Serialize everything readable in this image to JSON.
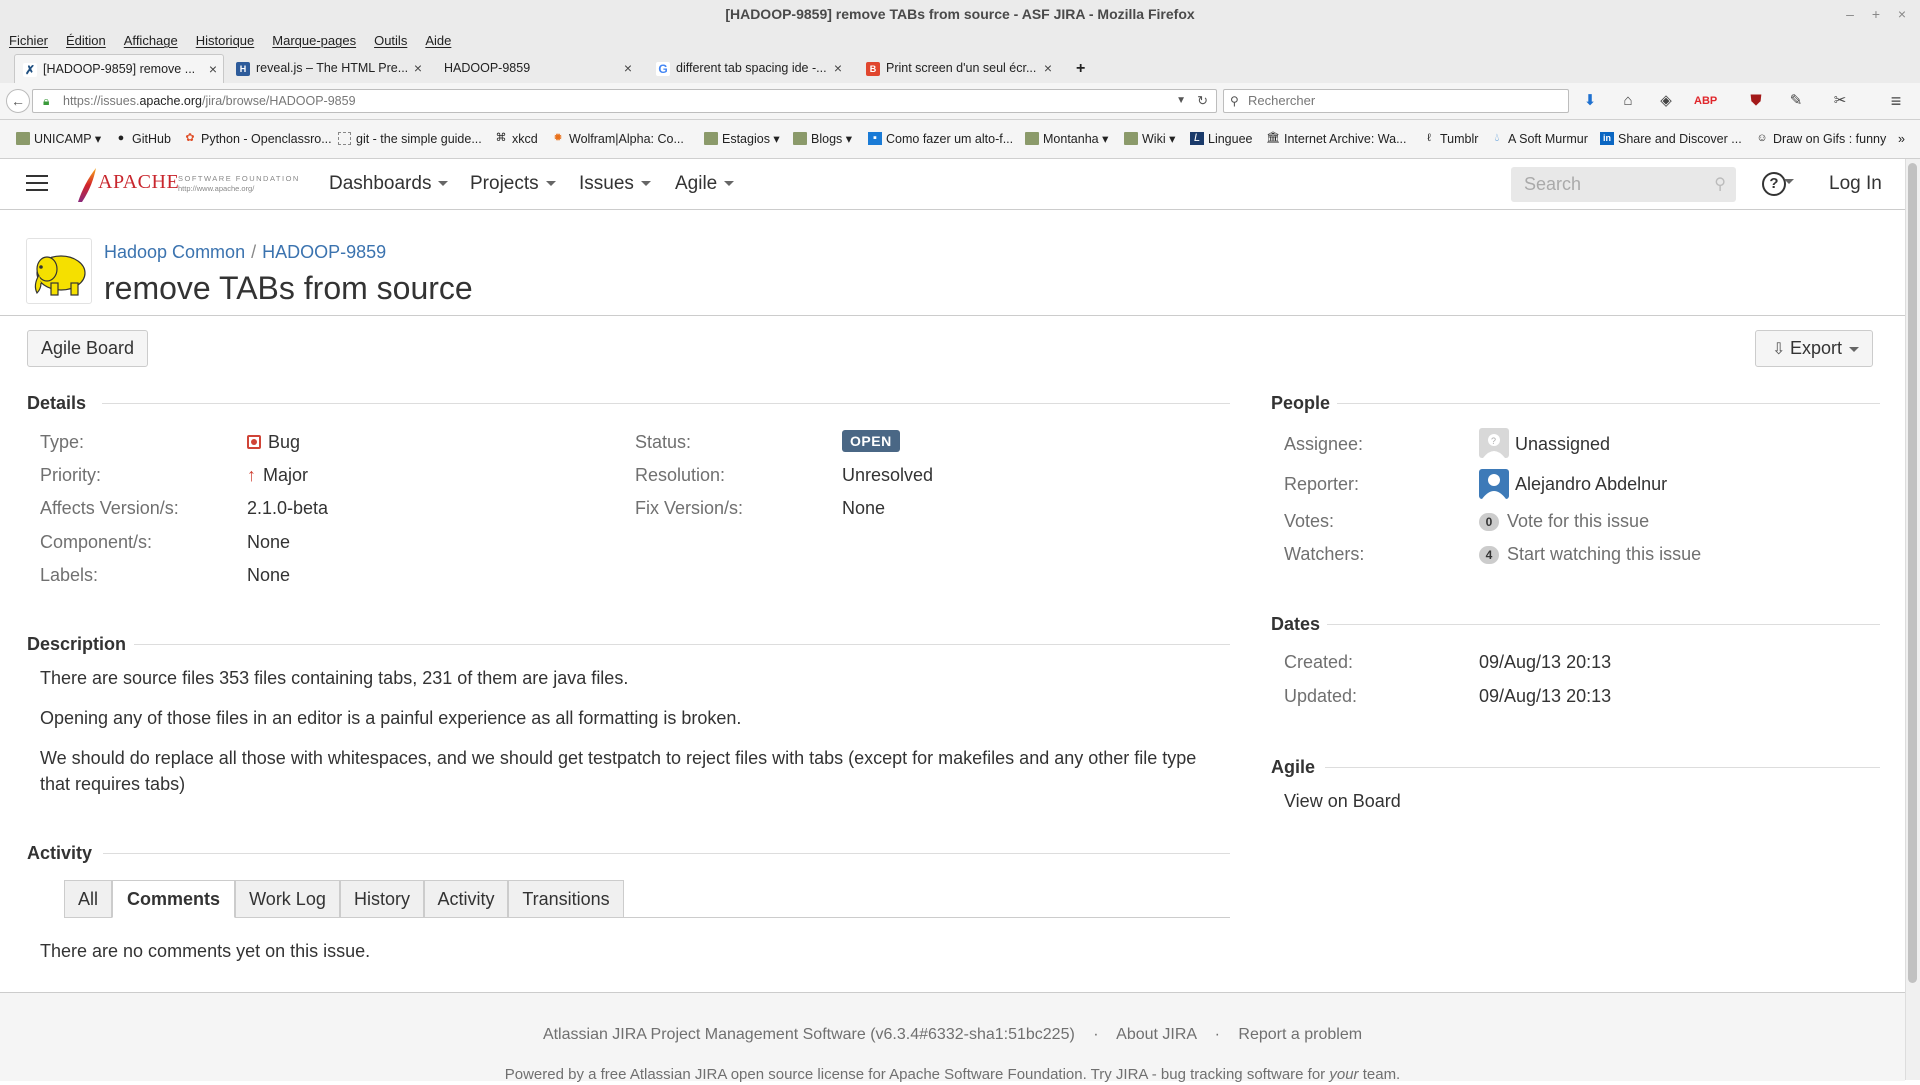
{
  "window": {
    "title": "[HADOOP-9859] remove TABs from source - ASF JIRA - Mozilla Firefox"
  },
  "menubar": [
    "Fichier",
    "Édition",
    "Affichage",
    "Historique",
    "Marque-pages",
    "Outils",
    "Aide"
  ],
  "tabs": [
    {
      "label": "[HADOOP-9859] remove ...",
      "active": true,
      "favicon": "jira-icon"
    },
    {
      "label": "reveal.js – The HTML Pre...",
      "active": false,
      "favicon": "reveal-icon"
    },
    {
      "label": "HADOOP-9859",
      "active": false,
      "favicon": ""
    },
    {
      "label": "different tab spacing ide -...",
      "active": false,
      "favicon": "google-icon"
    },
    {
      "label": "Print screen d'un seul écr...",
      "active": false,
      "favicon": "blogger-icon"
    }
  ],
  "navbar": {
    "url_prefix": "https://issues.",
    "url_domain": "apache.org",
    "url_path": "/jira/browse/HADOOP-9859",
    "search_placeholder": "Rechercher"
  },
  "bookmarks": [
    {
      "label": "UNICAMP",
      "type": "folder"
    },
    {
      "label": "GitHub",
      "type": "link"
    },
    {
      "label": "Python - Openclassro...",
      "type": "link"
    },
    {
      "label": "git - the simple guide...",
      "type": "link"
    },
    {
      "label": "xkcd",
      "type": "link"
    },
    {
      "label": "Wolfram|Alpha: Co...",
      "type": "link"
    },
    {
      "label": "Estagios",
      "type": "folder"
    },
    {
      "label": "Blogs",
      "type": "folder"
    },
    {
      "label": "Como fazer um alto-f...",
      "type": "link"
    },
    {
      "label": "Montanha",
      "type": "folder"
    },
    {
      "label": "Wiki",
      "type": "folder"
    },
    {
      "label": "Linguee",
      "type": "link"
    },
    {
      "label": "Internet Archive: Wa...",
      "type": "link"
    },
    {
      "label": "Tumblr",
      "type": "link"
    },
    {
      "label": "A Soft Murmur",
      "type": "link"
    },
    {
      "label": "Share and Discover ...",
      "type": "link"
    },
    {
      "label": "Draw on Gifs : funny",
      "type": "link"
    }
  ],
  "jira": {
    "nav": {
      "dashboards": "Dashboards",
      "projects": "Projects",
      "issues": "Issues",
      "agile": "Agile"
    },
    "search_placeholder": "Search",
    "login": "Log In",
    "breadcrumb": {
      "project": "Hadoop Common",
      "key": "HADOOP-9859"
    },
    "summary": "remove TABs from source",
    "toolbar": {
      "agile_board": "Agile Board",
      "export": "Export"
    },
    "details": {
      "heading": "Details",
      "type_label": "Type:",
      "type": "Bug",
      "priority_label": "Priority:",
      "priority": "Major",
      "affects_label": "Affects Version/s:",
      "affects": "2.1.0-beta",
      "components_label": "Component/s:",
      "components": "None",
      "labels_label": "Labels:",
      "labels": "None",
      "status_label": "Status:",
      "status": "OPEN",
      "resolution_label": "Resolution:",
      "resolution": "Unresolved",
      "fix_label": "Fix Version/s:",
      "fix": "None"
    },
    "description": {
      "heading": "Description",
      "p1": "There are source files 353 files containing tabs, 231 of them are java files.",
      "p2": "Opening any of those files in an editor is a painful experience as all formatting is broken.",
      "p3": "We should do replace all those with whitespaces, and we should get testpatch to reject files with tabs (except for makefiles and any other file type that requires tabs)"
    },
    "activity": {
      "heading": "Activity",
      "tabs": [
        "All",
        "Comments",
        "Work Log",
        "History",
        "Activity",
        "Transitions"
      ],
      "active_tab": "Comments",
      "empty": "There are no comments yet on this issue."
    },
    "people": {
      "heading": "People",
      "assignee_label": "Assignee:",
      "assignee": "Unassigned",
      "reporter_label": "Reporter:",
      "reporter": "Alejandro Abdelnur",
      "votes_label": "Votes:",
      "votes_count": "0",
      "votes_action": "Vote for this issue",
      "watchers_label": "Watchers:",
      "watchers_count": "4",
      "watchers_action": "Start watching this issue"
    },
    "dates": {
      "heading": "Dates",
      "created_label": "Created:",
      "created": "09/Aug/13 20:13",
      "updated_label": "Updated:",
      "updated": "09/Aug/13 20:13"
    },
    "agile": {
      "heading": "Agile",
      "link": "View on Board"
    },
    "footer": {
      "version": "Atlassian JIRA Project Management Software (v6.3.4#6332-sha1:51bc225)",
      "dot": "·",
      "about": "About JIRA",
      "report": "Report a problem",
      "powered_a": "Powered by a free Atlassian JIRA open source license for Apache Software Foundation. Try JIRA - bug tracking software for ",
      "powered_em": "your",
      "powered_b": " team."
    }
  },
  "colors": {
    "link": "#3b73af",
    "status_lozenge": "#4a6785",
    "bug_red": "#d04437",
    "chrome_bg": "#ebebeb"
  }
}
